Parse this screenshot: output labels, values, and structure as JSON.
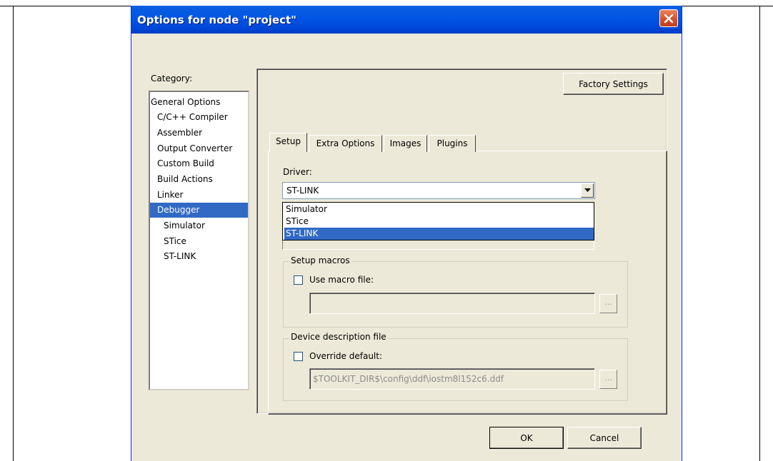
{
  "dialog": {
    "title": "Options for node \"project\"",
    "close_glyph": "✕",
    "colors": {
      "title_bar": "#0055e5",
      "close_button": "#d7502a",
      "selection": "#316ac5",
      "face": "#ece9d8"
    }
  },
  "category": {
    "label": "Category:",
    "items": [
      {
        "label": "General Options",
        "selected": false,
        "indent": 0
      },
      {
        "label": "C/C++ Compiler",
        "selected": false,
        "indent": 1
      },
      {
        "label": "Assembler",
        "selected": false,
        "indent": 1
      },
      {
        "label": "Output Converter",
        "selected": false,
        "indent": 1
      },
      {
        "label": "Custom Build",
        "selected": false,
        "indent": 1
      },
      {
        "label": "Build Actions",
        "selected": false,
        "indent": 1
      },
      {
        "label": "Linker",
        "selected": false,
        "indent": 1
      },
      {
        "label": "Debugger",
        "selected": true,
        "indent": 1
      },
      {
        "label": "Simulator",
        "selected": false,
        "indent": 2
      },
      {
        "label": "STice",
        "selected": false,
        "indent": 2
      },
      {
        "label": "ST-LINK",
        "selected": false,
        "indent": 2
      }
    ]
  },
  "factory_settings_label": "Factory Settings",
  "tabs": [
    {
      "label": "Setup",
      "active": true
    },
    {
      "label": "Extra Options",
      "active": false
    },
    {
      "label": "Images",
      "active": false
    },
    {
      "label": "Plugins",
      "active": false
    }
  ],
  "setup": {
    "driver_label": "Driver:",
    "driver_value": "ST-LINK",
    "driver_options": [
      {
        "label": "Simulator",
        "selected": false
      },
      {
        "label": "STice",
        "selected": false
      },
      {
        "label": "ST-LINK",
        "selected": true
      }
    ],
    "setup_macros": {
      "title": "Setup macros",
      "checkbox_label": "Use macro file:",
      "checked": false,
      "path": "",
      "browse_label": "..."
    },
    "device_description": {
      "title": "Device description file",
      "checkbox_label": "Override default:",
      "checked": false,
      "path": "$TOOLKIT_DIR$\\config\\ddf\\iostm8l152c6.ddf",
      "browse_label": "..."
    }
  },
  "footer": {
    "ok_label": "OK",
    "cancel_label": "Cancel"
  }
}
